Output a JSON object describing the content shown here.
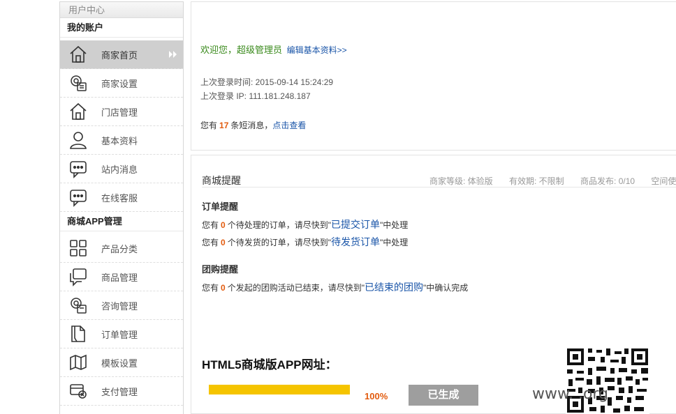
{
  "sidebar": {
    "header": "用户中心",
    "sections": [
      {
        "title": "我的账户",
        "items": [
          {
            "label": "商家首页",
            "icon": "home-icon"
          },
          {
            "label": "商家设置",
            "icon": "settings-icon"
          },
          {
            "label": "门店管理",
            "icon": "store-icon"
          },
          {
            "label": "基本资料",
            "icon": "user-icon"
          },
          {
            "label": "站内消息",
            "icon": "message-icon"
          },
          {
            "label": "在线客服",
            "icon": "chat-icon"
          }
        ]
      },
      {
        "title": "商城APP管理",
        "items": [
          {
            "label": "产品分类",
            "icon": "grid-icon"
          },
          {
            "label": "商品管理",
            "icon": "comment-icon"
          },
          {
            "label": "咨询管理",
            "icon": "consult-icon"
          },
          {
            "label": "订单管理",
            "icon": "document-icon"
          },
          {
            "label": "模板设置",
            "icon": "map-icon"
          },
          {
            "label": "支付管理",
            "icon": "payment-icon"
          }
        ]
      }
    ]
  },
  "welcome": {
    "greeting": "欢迎您，超级管理员",
    "edit_link": "编辑基本资料>>",
    "last_login_time": "上次登录时间: 2015-09-14 15:24:29",
    "last_login_ip": "上次登录 IP: 111.181.248.187",
    "msg_prefix": "您有",
    "msg_count": "17",
    "msg_suffix": "条短消息，",
    "msg_link": "点击查看"
  },
  "mall": {
    "title": "商城提醒",
    "level": "商家等级: 体验版",
    "validity": "有效期: 不限制",
    "products": "商品发布: 0/10",
    "space": "空间使用"
  },
  "orders": {
    "title": "订单提醒",
    "line1": {
      "prefix": "您有",
      "count": "0",
      "mid": "个待处理的订单，请尽快到\"",
      "link": "已提交订单",
      "suffix": "\"中处理"
    },
    "line2": {
      "prefix": "您有",
      "count": "0",
      "mid": "个待发货的订单，请尽快到\"",
      "link": "待发货订单",
      "suffix": "\"中处理"
    }
  },
  "group_buy": {
    "title": "团购提醒",
    "line": {
      "prefix": "您有",
      "count": "0",
      "mid": "个发起的团购活动已结束，请尽快到\"",
      "link": "已结束的团购",
      "suffix": "\"中确认完成"
    }
  },
  "html5": {
    "title": "HTML5商城版APP网址：",
    "progress": 1.0,
    "progress_label": "100%",
    "button": "已生成"
  },
  "watermark": "www.          .org",
  "colors": {
    "accent_orange": "#e25b0e",
    "link_blue": "#1a55a8",
    "welcome_green": "#3a8a1c",
    "progress_yellow": "#f5c400"
  }
}
